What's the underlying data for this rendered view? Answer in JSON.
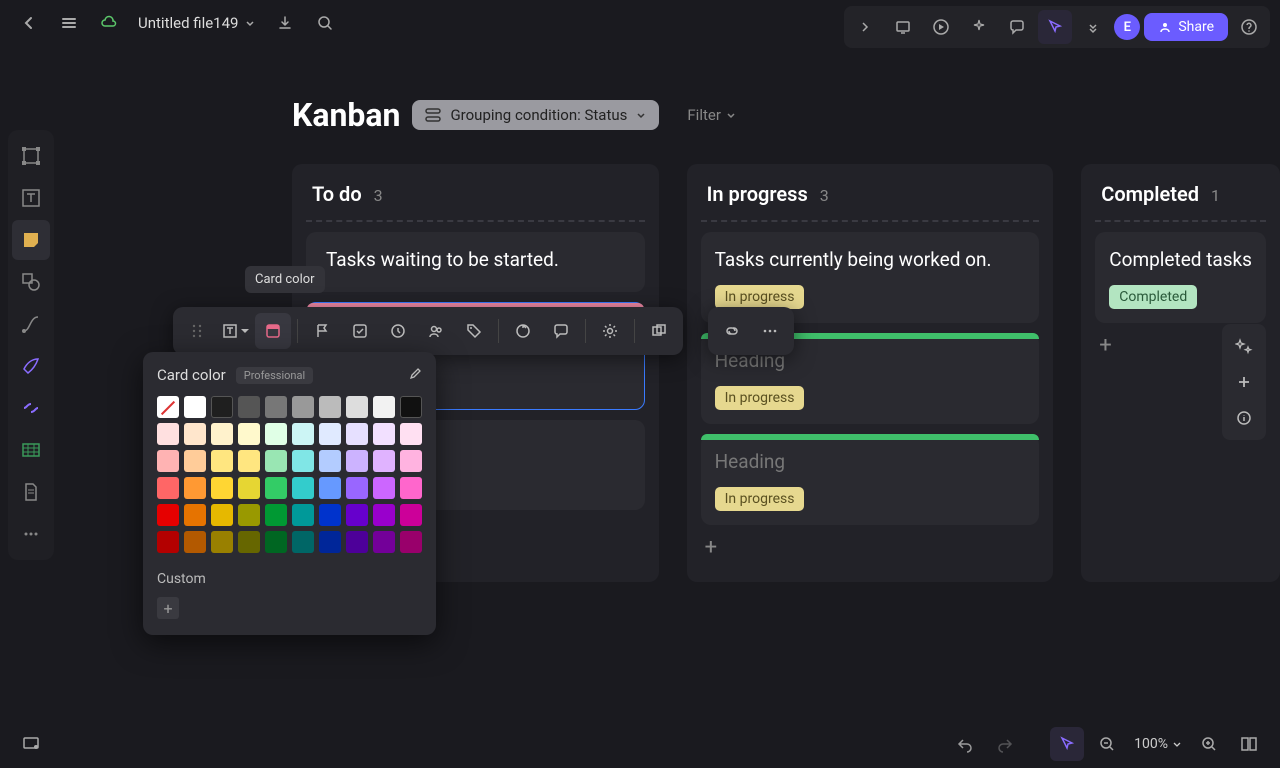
{
  "topbar": {
    "file_name": "Untitled file149",
    "share_label": "Share",
    "avatar_initial": "E"
  },
  "board": {
    "title": "Kanban",
    "grouping_label": "Grouping condition: Status",
    "filter_label": "Filter"
  },
  "columns": [
    {
      "title": "To do",
      "count": "3",
      "cards": [
        {
          "desc": "Tasks waiting to be started."
        }
      ]
    },
    {
      "title": "In progress",
      "count": "3",
      "cards": [
        {
          "desc": "Tasks currently being worked on.",
          "badge": "In progress"
        },
        {
          "desc": "Heading",
          "badge": "In progress",
          "dim": true
        },
        {
          "desc": "Heading",
          "badge": "In progress",
          "dim": true
        }
      ]
    },
    {
      "title": "Completed",
      "count": "1",
      "cards": [
        {
          "desc": "Completed tasks",
          "badge": "Completed"
        }
      ]
    }
  ],
  "tooltip": {
    "text": "Card color"
  },
  "picker": {
    "title": "Card color",
    "tag": "Professional",
    "custom_label": "Custom",
    "row0": [
      "none",
      "#ffffff",
      "#1f1f1f",
      "#555555",
      "#777777",
      "#999999",
      "#bbbbbb",
      "#dddddd",
      "#f2f2f2",
      "#111111"
    ],
    "row1": [
      "#ffe0e0",
      "#ffe6cc",
      "#fff2cc",
      "#fff9cc",
      "#e0ffe6",
      "#ccf5f5",
      "#e0eaff",
      "#e6e0ff",
      "#f2e0ff",
      "#ffe0f2"
    ],
    "row2": [
      "#ffb3b3",
      "#ffcc99",
      "#ffe680",
      "#ffe680",
      "#99e6b3",
      "#80e6e6",
      "#b3ccff",
      "#ccb3ff",
      "#e0b3ff",
      "#ffb3e0"
    ],
    "row3": [
      "#ff6666",
      "#ff9933",
      "#ffd633",
      "#e6d633",
      "#33cc66",
      "#33cccc",
      "#6699ff",
      "#9966ff",
      "#cc66ff",
      "#ff66cc"
    ],
    "row4": [
      "#e60000",
      "#e67300",
      "#e6b800",
      "#999900",
      "#009933",
      "#009999",
      "#0033cc",
      "#6600cc",
      "#9900cc",
      "#cc0099"
    ],
    "row5": [
      "#b30000",
      "#b35900",
      "#998000",
      "#666600",
      "#006622",
      "#006666",
      "#002699",
      "#4d0099",
      "#730099",
      "#99006b"
    ]
  },
  "bottombar": {
    "zoom": "100%"
  }
}
